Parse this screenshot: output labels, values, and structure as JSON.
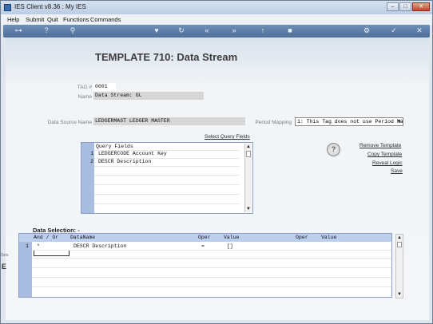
{
  "window": {
    "title": "IES Client v8.36 : My IES",
    "buttons": [
      "–",
      "□",
      "✕"
    ]
  },
  "menu": [
    "Help",
    "Submit",
    "Quit",
    "Functions",
    "Commands"
  ],
  "toolbar": {
    "icons": [
      "key-icon",
      "help-icon",
      "search-icon",
      "heart-icon",
      "refresh-icon",
      "rewind-icon",
      "forward-icon",
      "upload-icon",
      "stop-icon",
      "settings-icon",
      "check-icon",
      "close-icon"
    ]
  },
  "page": {
    "title": "TEMPLATE 710: Data Stream"
  },
  "form": {
    "tag_label": "TAG #",
    "tag_value": "0001",
    "name_label": "Name",
    "name_value": "Data Stream: GL",
    "datasource_label": "Data Source Name",
    "datasource_value": "LEDGERMAST LEDGER MASTER",
    "period_mapping_label": "Period Mapping",
    "period_mapping_value": "1: This Tag does not use Period Ma"
  },
  "links": {
    "select_query_fields": "Select Query Fields",
    "remove_template": "Remove Template",
    "copy_template": "Copy Template",
    "reveal_logic": "Reveal Logic",
    "save": "Save"
  },
  "query_fields": {
    "header": "Query Fields",
    "rows": [
      {
        "num": "1",
        "text": "LEDGERCODE Account Key"
      },
      {
        "num": "2",
        "text": "DESCR Description"
      }
    ]
  },
  "data_selection": {
    "label": "Data Selection: -",
    "columns": [
      "And / Or",
      "DataName",
      "Oper",
      "Value",
      "Oper",
      "Value"
    ],
    "rows": [
      {
        "num": "1",
        "andor": "*",
        "dataname": "DESCR Description",
        "oper": "=",
        "value": "[]"
      }
    ]
  },
  "left_strip": {
    "text1": "Ses",
    "text2": "E"
  }
}
